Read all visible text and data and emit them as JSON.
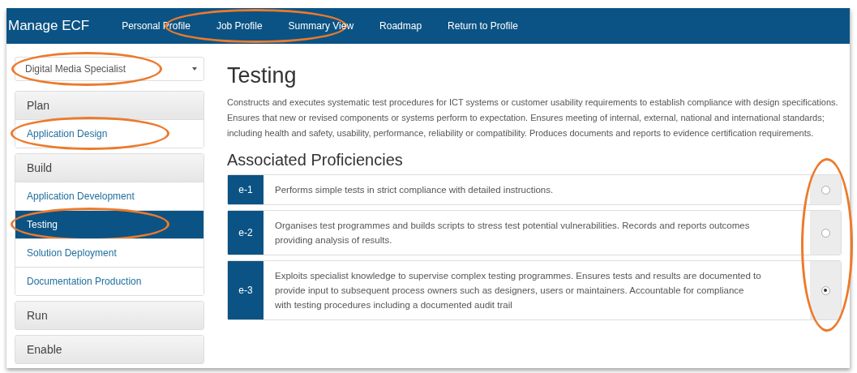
{
  "navbar": {
    "brand": "Manage ECF",
    "items": [
      {
        "label": "Personal Profile",
        "highlighted": false
      },
      {
        "label": "Job Profile",
        "highlighted": true
      },
      {
        "label": "Summary View",
        "highlighted": false
      },
      {
        "label": "Roadmap",
        "highlighted": false
      },
      {
        "label": "Return to Profile",
        "highlighted": false
      }
    ]
  },
  "sidebar": {
    "role_select": {
      "value": "Digital Media Specialist",
      "highlighted": true
    },
    "groups": [
      {
        "label": "Plan",
        "items": [
          {
            "label": "Application Design",
            "selected": false,
            "highlighted": true
          }
        ]
      },
      {
        "label": "Build",
        "items": [
          {
            "label": "Application Development",
            "selected": false,
            "highlighted": false
          },
          {
            "label": "Testing",
            "selected": true,
            "highlighted": true
          },
          {
            "label": "Solution Deployment",
            "selected": false,
            "highlighted": false
          },
          {
            "label": "Documentation Production",
            "selected": false,
            "highlighted": false
          }
        ]
      },
      {
        "label": "Run"
      },
      {
        "label": "Enable"
      }
    ]
  },
  "main": {
    "title": "Testing",
    "description": "Constructs and executes systematic test procedures for ICT systems or customer usability requirements to establish compliance with design specifications. Ensures that new or revised components or systems perform to expectation. Ensures meeting of internal, external, national and international standards; including health and safety, usability, performance, reliability or compatibility. Produces documents and reports to evidence certification requirements.",
    "section_title": "Associated Proficiencies",
    "choices_highlighted": true,
    "proficiencies": [
      {
        "level": "e-1",
        "text": "Performs simple tests in strict compliance with detailed instructions.",
        "selected": false
      },
      {
        "level": "e-2",
        "text": "Organises test programmes and builds scripts to stress test potential vulnerabilities. Records and reports outcomes providing analysis of results.",
        "selected": false
      },
      {
        "level": "e-3",
        "text": "Exploits specialist knowledge to supervise complex testing programmes. Ensures tests and results are documented to provide input to subsequent process owners such as designers, users or maintainers. Accountable for compliance with testing procedures including a documented audit trail",
        "selected": true
      }
    ]
  }
}
